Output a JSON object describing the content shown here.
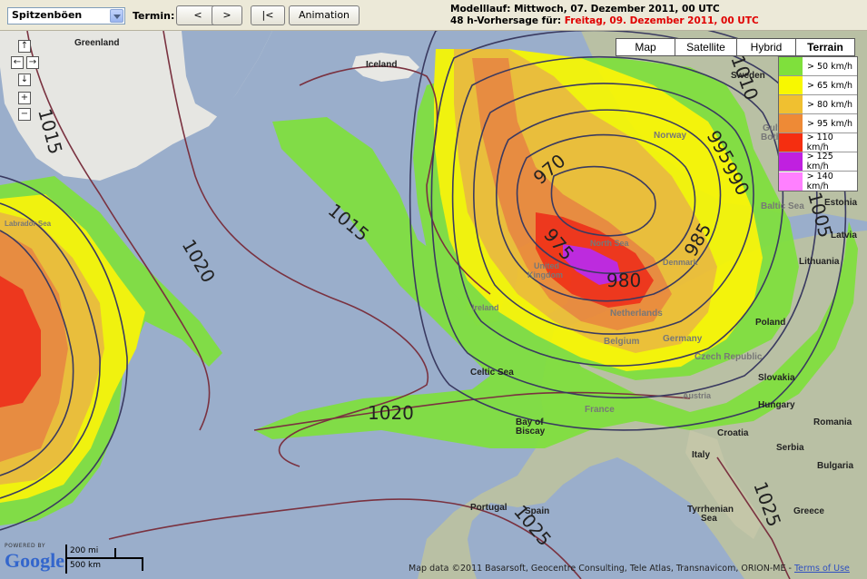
{
  "toolbar": {
    "parameter": "Spitzenböen",
    "termin_label": "Termin:",
    "btn_prev": "<",
    "btn_next": ">",
    "btn_first": "|<",
    "btn_animation": "Animation",
    "run_line": "Modelllauf: Mittwoch, 07. Dezember 2011, 00 UTC",
    "forecast_prefix": "48 h-Vorhersage für: ",
    "forecast_date": "Freitag, 09. Dezember 2011, 00 UTC"
  },
  "map_types": [
    "Map",
    "Satellite",
    "Hybrid",
    "Terrain"
  ],
  "active_map_type": "Terrain",
  "legend": [
    {
      "label": "> 50 km/h",
      "color": "#7fe03c"
    },
    {
      "label": "> 65 km/h",
      "color": "#f8f800"
    },
    {
      "label": "> 80 km/h",
      "color": "#f0c030"
    },
    {
      "label": "> 95 km/h",
      "color": "#ee8a36"
    },
    {
      "label": "> 110 km/h",
      "color": "#f52e10"
    },
    {
      "label": "> 125 km/h",
      "color": "#c020e0"
    },
    {
      "label": "> 140 km/h",
      "color": "#ff80ff"
    }
  ],
  "isobars": {
    "labels": [
      "1015",
      "1020",
      "1015",
      "1020",
      "970",
      "975",
      "980",
      "985",
      "990",
      "995",
      "1005",
      "1025",
      "1025",
      "1010"
    ]
  },
  "places": {
    "greenland": "Greenland",
    "iceland": "Iceland",
    "sweden": "Sweden",
    "norway": "Norway",
    "gulf_bothnia_1": "Gulf",
    "gulf_bothnia_2": "Both",
    "estonia": "Estonia",
    "baltic": "Baltic Sea",
    "latvia": "Latvia",
    "lithuania": "Lithuania",
    "north_sea": "North Sea",
    "denmark": "Denmark",
    "united_kingdom_1": "United",
    "united_kingdom_2": "Kingdom",
    "ireland": "Ireland",
    "netherlands": "Netherlands",
    "belgium": "Belgium",
    "germany": "Germany",
    "poland": "Poland",
    "czech": "Czech Republic",
    "slovakia": "Slovakia",
    "austria": "Austria",
    "hungary": "Hungary",
    "romania": "Romania",
    "france": "France",
    "croatia": "Croatia",
    "serbia": "Serbia",
    "bulgaria": "Bulgaria",
    "italy": "Italy",
    "celtic_sea": "Celtic Sea",
    "biscay_1": "Bay of",
    "biscay_2": "Biscay",
    "portugal": "Portugal",
    "spain": "Spain",
    "tyrrhenian_1": "Tyrrhenian",
    "tyrrhenian_2": "Sea",
    "greece": "Greece",
    "labrador": "Labrador Sea"
  },
  "footer": {
    "powered_by": "POWERED BY",
    "google": "Google",
    "scale_mi": "200 mi",
    "scale_km": "500 km",
    "attribution": "Map data ©2011 Basarsoft, Geocentre Consulting, Tele Atlas, Transnavicom, ORION-ME - ",
    "terms": "Terms of Use"
  }
}
